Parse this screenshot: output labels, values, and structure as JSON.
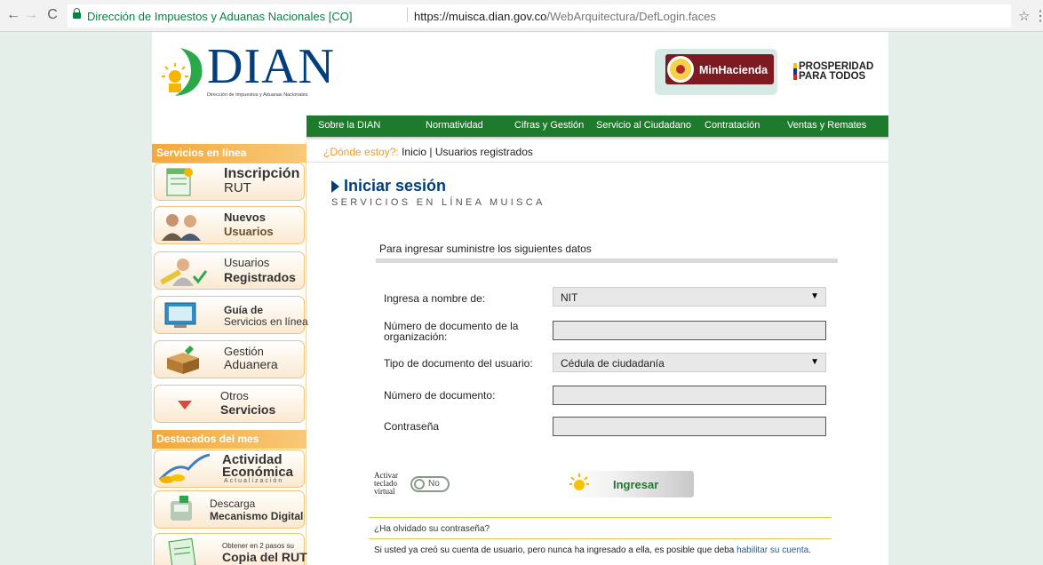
{
  "browser": {
    "site_name": "Dirección de Impuestos y Aduanas Nacionales [CO]",
    "url_host": "https://muisca.dian.gov.co",
    "url_path": "/WebArquitectura/DefLogin.faces"
  },
  "header": {
    "logo_text": "DIAN",
    "logo_subtext": "Dirección de Impuestos y Aduanas Nacionales",
    "minhacienda": "MinHacienda",
    "prosperidad_1": "PROSPERIDAD",
    "prosperidad_2": "PARA TODOS"
  },
  "topnav": [
    "Sobre la DIAN",
    "Normatividad",
    "Cifras y Gestión",
    "Servicio al Ciudadano",
    "Contratación",
    "Ventas y Remates"
  ],
  "breadcrumb": {
    "question": "¿Dónde estoy?:",
    "current": "Inicio | Usuarios registrados"
  },
  "sidebar": {
    "section_online": "Servicios en línea",
    "section_featured": "Destacados del mes",
    "items": [
      {
        "l1": "Inscripción",
        "l2": "RUT"
      },
      {
        "l1": "Nuevos",
        "l2": "Usuarios"
      },
      {
        "l1": "Usuarios",
        "l2": "Registrados"
      },
      {
        "l1": "Guía de",
        "l2": "Servicios en línea"
      },
      {
        "l1": "Gestión",
        "l2": "Aduanera"
      },
      {
        "l1": "Otros",
        "l2": "Servicios"
      }
    ],
    "featured": [
      {
        "l1": "Actividad",
        "l2": "Económica",
        "l3": "Actualización"
      },
      {
        "l1": "Descarga",
        "l2": "Mecanismo Digital"
      },
      {
        "l1": "Obtener en 2 pasos su",
        "l2": "Copia del RUT"
      }
    ]
  },
  "main": {
    "title": "Iniciar sesión",
    "subtitle": "SERVICIOS EN LÍNEA MUISCA",
    "intro": "Para ingresar suministre los siguientes datos",
    "fields": {
      "nombre_label": "Ingresa a nombre de:",
      "nombre_value": "NIT",
      "numdoc_org_label": "Número de documento de la organización:",
      "tipo_label": "Tipo de documento del usuario:",
      "tipo_value": "Cédula de ciudadanía",
      "numdoc_label": "Número de documento:",
      "password_label": "Contraseña"
    },
    "virtual_kb_label_1": "Activar",
    "virtual_kb_label_2": "teclado",
    "virtual_kb_label_3": "virtual",
    "toggle_text": "No",
    "submit": "Ingresar",
    "forgot": "¿Ha olvidado su contraseña?",
    "note_text": "Si usted ya creó su cuenta de usuario, pero nunca ha ingresado a ella, es posible que deba ",
    "note_link": "habilitar su cuenta",
    "note_end": "."
  }
}
